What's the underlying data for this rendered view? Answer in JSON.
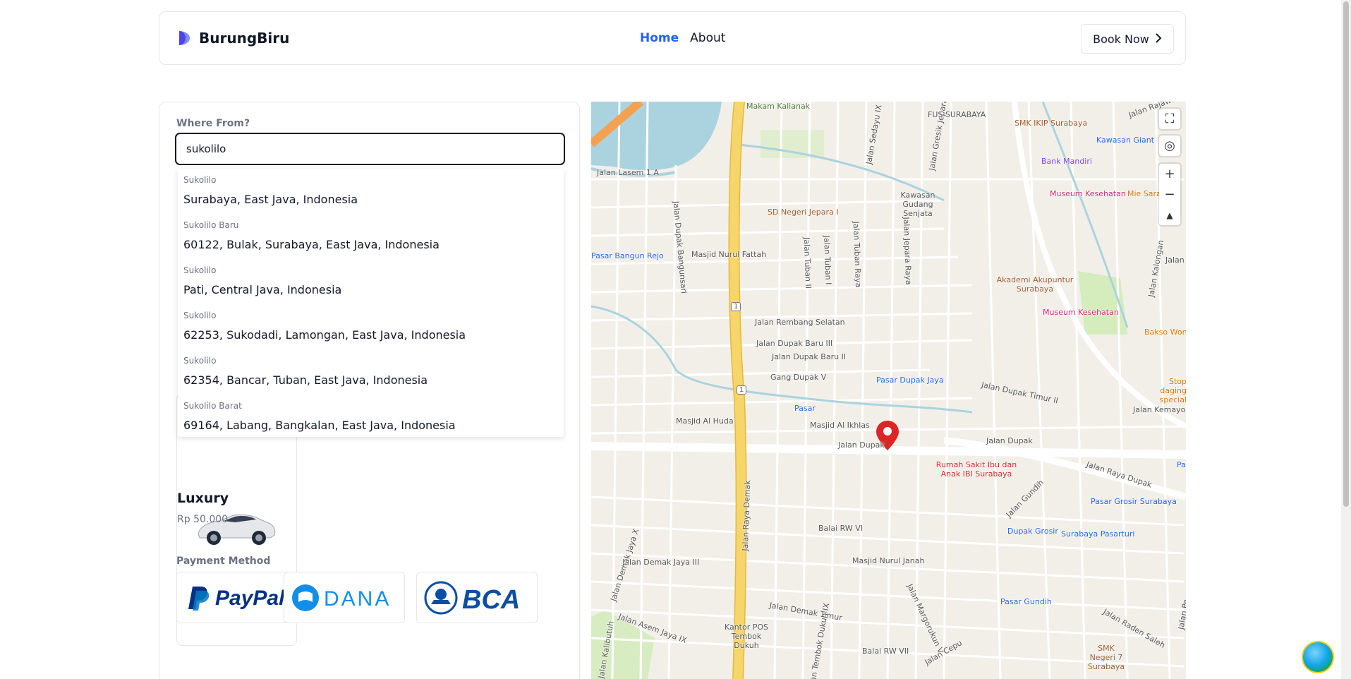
{
  "header": {
    "brand": "BurungBiru",
    "nav": {
      "home": "Home",
      "about": "About"
    },
    "book_now": "Book Now"
  },
  "form": {
    "where_from_label": "Where From?",
    "search_value": "sukolilo",
    "suggestions": [
      {
        "name": "Sukolilo",
        "address": "Surabaya, East Java, Indonesia"
      },
      {
        "name": "Sukolilo Baru",
        "address": "60122, Bulak, Surabaya, East Java, Indonesia"
      },
      {
        "name": "Sukolilo",
        "address": "Pati, Central Java, Indonesia"
      },
      {
        "name": "Sukolilo",
        "address": "62253, Sukodadi, Lamongan, East Java, Indonesia"
      },
      {
        "name": "Sukolilo",
        "address": "62354, Bancar, Tuban, East Java, Indonesia"
      },
      {
        "name": "Sukolilo Barat",
        "address": "69164, Labang, Bangkalan, East Java, Indonesia"
      }
    ],
    "car": {
      "name": "Luxury",
      "price": "Rp 50.000"
    },
    "payment_label": "Payment Method",
    "payments": {
      "paypal": "PayPal",
      "dana": "DANA",
      "bca": "BCA"
    }
  },
  "map": {
    "streets": {
      "jalan_lasem": "Jalan Lasem 1 A",
      "makam": "Makam Kalianak",
      "jalan_sedayu": "Jalan Sedayu IX",
      "jalan_gresik": "Jalan Gresik Jepara",
      "jalan_dupak_bangunsari": "Jalan Dupak Bangunsari",
      "jalan_tuban_i": "Jalan Tuban I",
      "jalan_tuban_ii": "Jalan Tuban II",
      "jalan_tuban_raya": "Jalan Tuban Raya",
      "jalan_jepara_raya": "Jalan Jepara Raya",
      "jalan_rembang": "Jalan Rembang Selatan",
      "jalan_dupak_baru_iii": "Jalan Dupak Baru III",
      "jalan_dupak_baru_ii": "Jalan Dupak Baru II",
      "gang_dupak_v": "Gang Dupak V",
      "jalan_dupak": "Jalan Dupak",
      "jalan_dupak_2": "Jalan Dupak",
      "jalan_raya_demak": "Jalan Raya Demak",
      "jalan_raya_dupak": "Jalan Raya Dupak",
      "jalan_dupak_timur": "Jalan Dupak Timur II",
      "jalan_kemayoran": "Jalan Kemayoran",
      "jalan_demak_jaya_iii": "Jalan Demak Jaya III",
      "jalan_demak_jaya_x": "Jalan Demak Jaya X",
      "jalan_asem_jaya": "Jalan Asem Jaya IX",
      "jalan_demak_timur": "Jalan Demak Timur",
      "jalan_tembok_dukuh": "Jalan Tembok Dukuh IX",
      "jalan_margorukun": "Jalan Margorukun V",
      "jalan_cepu": "Jalan Cepu",
      "jalan_gundih": "Jalan Gundih",
      "jalan_raden_saleh": "Jalan Raden Saleh",
      "jalan_kalongan": "Jalan Kalongan",
      "jalan_rajawali": "Jalan Rajawali",
      "jalan_kalibutuh": "Jalan Kalibutuh",
      "jalan_jaya": "Jalan",
      "jalan_pe": "Jalan Pe",
      "pa": "Pa",
      "route_1": "1",
      "route_1b": "1"
    },
    "pois": {
      "fus": "FUS SURABAYA",
      "smk_ikip": "SMK IKIP Surabaya",
      "kawasan_giant": "Kawasan Giant",
      "bank_mandiri": "Bank Mandiri",
      "museum_kesehatan": "Museum Kesehatan",
      "mie_sara": "Mie Sara",
      "kawasan_gudang": "Kawasan Gudang Senjata",
      "sd_negeri": "SD Negeri Jepara I",
      "pasar_bangun_rejo": "Pasar Bangun Rejo",
      "masjid_nurul_fattah": "Masjid Nurul Fattah",
      "akademi": "Akademi Akupuntur Surabaya",
      "museum_kesehatan_2": "Museum Kesehatan",
      "bakso": "Bakso Won",
      "pasar_dupak_jaya": "Pasar Dupak Jaya",
      "stop_dagin": "Stop daging special",
      "pasar": "Pasar",
      "masjid_al_huda": "Masjid Al Huda",
      "masjid_al_ikhlas": "Masjid Al Ikhlas",
      "rumah_sakit": "Rumah Sakit Ibu dan Anak IBI Surabaya",
      "pasar_grosir": "Pasar Grosir Surabaya",
      "dupak_grosir": "Dupak Grosir",
      "surabaya_pasarturi": "Surabaya Pasarturi",
      "balai_rw_vi": "Balai RW VI",
      "masjid_nurul_janah": "Masjid Nurul Janah",
      "pasar_gundih": "Pasar Gundih",
      "kantor_pos": "Kantor POS Tembok Dukuh",
      "balai_rw_vii": "Balai RW VII",
      "smk_negeri": "SMK Negeri 7 Surabaya"
    }
  },
  "colors": {
    "accent": "#2563eb",
    "pin": "#dc2626",
    "highway": "#f6d56a",
    "water": "#aad3df"
  }
}
